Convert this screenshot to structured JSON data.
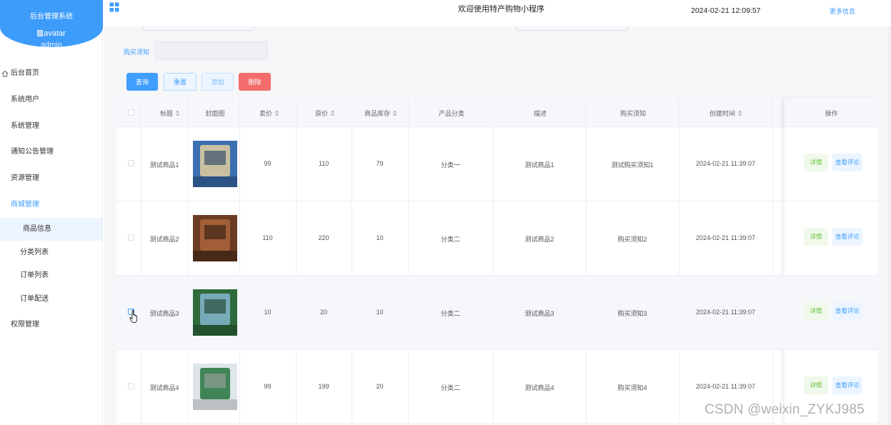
{
  "sidebar": {
    "brand_title": "后台管理系统",
    "avatar_alt": "avatar",
    "username": "admin",
    "items": [
      {
        "label": "后台首页"
      },
      {
        "label": "系统用户"
      },
      {
        "label": "系统管理"
      },
      {
        "label": "通知公告管理"
      },
      {
        "label": "资源管理"
      },
      {
        "label": "商城管理"
      },
      {
        "label": "商品信息"
      },
      {
        "label": "分类列表"
      },
      {
        "label": "订单列表"
      },
      {
        "label": "订单配送"
      },
      {
        "label": "权限管理"
      }
    ]
  },
  "header": {
    "title": "欢迎使用特产购物小程序",
    "datetime": "2024-02-21 12:09:57",
    "more": "更多信息"
  },
  "search": {
    "label": "购买须知",
    "value": ""
  },
  "buttons": {
    "query": "查询",
    "reset": "重置",
    "add": "添加",
    "delete": "删除"
  },
  "table": {
    "columns": [
      "标题",
      "封面图",
      "卖价",
      "原价",
      "商品库存",
      "产品分类",
      "描述",
      "购买须知",
      "创建时间",
      "操作"
    ],
    "rows": [
      {
        "title": "测试商品1",
        "price": "99",
        "orig": "110",
        "stock": "79",
        "category": "分类一",
        "desc": "测试商品1",
        "notice": "测试购买须知1",
        "created": "2024-02-21 11:39:07"
      },
      {
        "title": "测试商品2",
        "price": "110",
        "orig": "220",
        "stock": "10",
        "category": "分类二",
        "desc": "测试商品2",
        "notice": "购买须知2",
        "created": "2024-02-21 11:39:07"
      },
      {
        "title": "测试商品3",
        "price": "10",
        "orig": "20",
        "stock": "10",
        "category": "分类二",
        "desc": "测试商品3",
        "notice": "购买须知3",
        "created": "2024-02-21 11:39:07"
      },
      {
        "title": "测试商品4",
        "price": "99",
        "orig": "199",
        "stock": "20",
        "category": "分类二",
        "desc": "测试商品4",
        "notice": "购买须知4",
        "created": "2024-02-21 11:39:07"
      }
    ],
    "actions": {
      "detail": "详情",
      "review": "查看评论"
    }
  },
  "watermark": "CSDN @weixin_ZYKJ985",
  "colors": {
    "primary": "#409eff",
    "danger": "#f56c6c",
    "success": "#67c23a",
    "brand": "#3d9bf9"
  }
}
